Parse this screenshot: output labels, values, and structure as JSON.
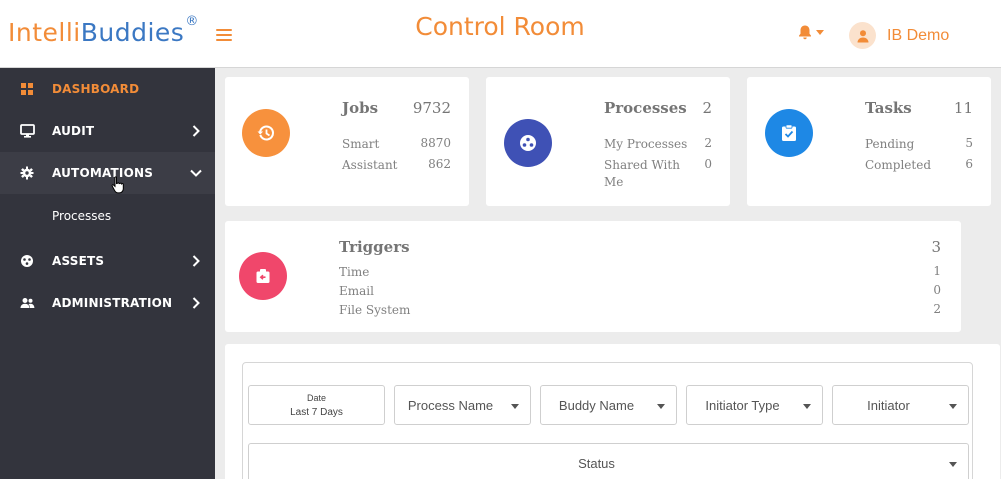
{
  "header": {
    "logo_part1": "Intelli",
    "logo_part2": "Buddies",
    "logo_reg": "®",
    "title": "Control Room",
    "user_name": "IB Demo"
  },
  "sidebar": {
    "items": [
      {
        "label": "DASHBOARD",
        "icon": "grid-icon"
      },
      {
        "label": "AUDIT",
        "icon": "monitor-icon"
      },
      {
        "label": "AUTOMATIONS",
        "icon": "gear-icon"
      },
      {
        "label": "ASSETS",
        "icon": "palette-icon"
      },
      {
        "label": "ADMINISTRATION",
        "icon": "users-icon"
      }
    ],
    "sub_items": [
      {
        "label": "Processes"
      }
    ]
  },
  "cards": {
    "jobs": {
      "title": "Jobs",
      "total": "9732",
      "rows": [
        {
          "label": "Smart",
          "value": "8870"
        },
        {
          "label": "Assistant",
          "value": "862"
        }
      ]
    },
    "processes": {
      "title": "Processes",
      "total": "2",
      "rows": [
        {
          "label": "My Processes",
          "value": "2"
        },
        {
          "label": "Shared With Me",
          "value": "0"
        }
      ]
    },
    "tasks": {
      "title": "Tasks",
      "total": "11",
      "rows": [
        {
          "label": "Pending",
          "value": "5"
        },
        {
          "label": "Completed",
          "value": "6"
        }
      ]
    },
    "triggers": {
      "title": "Triggers",
      "total": "3",
      "rows": [
        {
          "label": "Time",
          "value": "1"
        },
        {
          "label": "Email",
          "value": "0"
        },
        {
          "label": "File System",
          "value": "2"
        }
      ]
    }
  },
  "filters": {
    "date_label": "Date",
    "date_value": "Last 7 Days",
    "process_name": "Process Name",
    "buddy_name": "Buddy Name",
    "initiator_type": "Initiator Type",
    "initiator": "Initiator",
    "status": "Status"
  },
  "colors": {
    "accent": "#f28c38",
    "brand_blue": "#3b78c3",
    "sidebar_bg": "#33343d",
    "jobs_circle": "#f7913d",
    "processes_circle": "#3f51b5",
    "tasks_circle": "#1e88e5",
    "triggers_circle": "#f0476b"
  }
}
